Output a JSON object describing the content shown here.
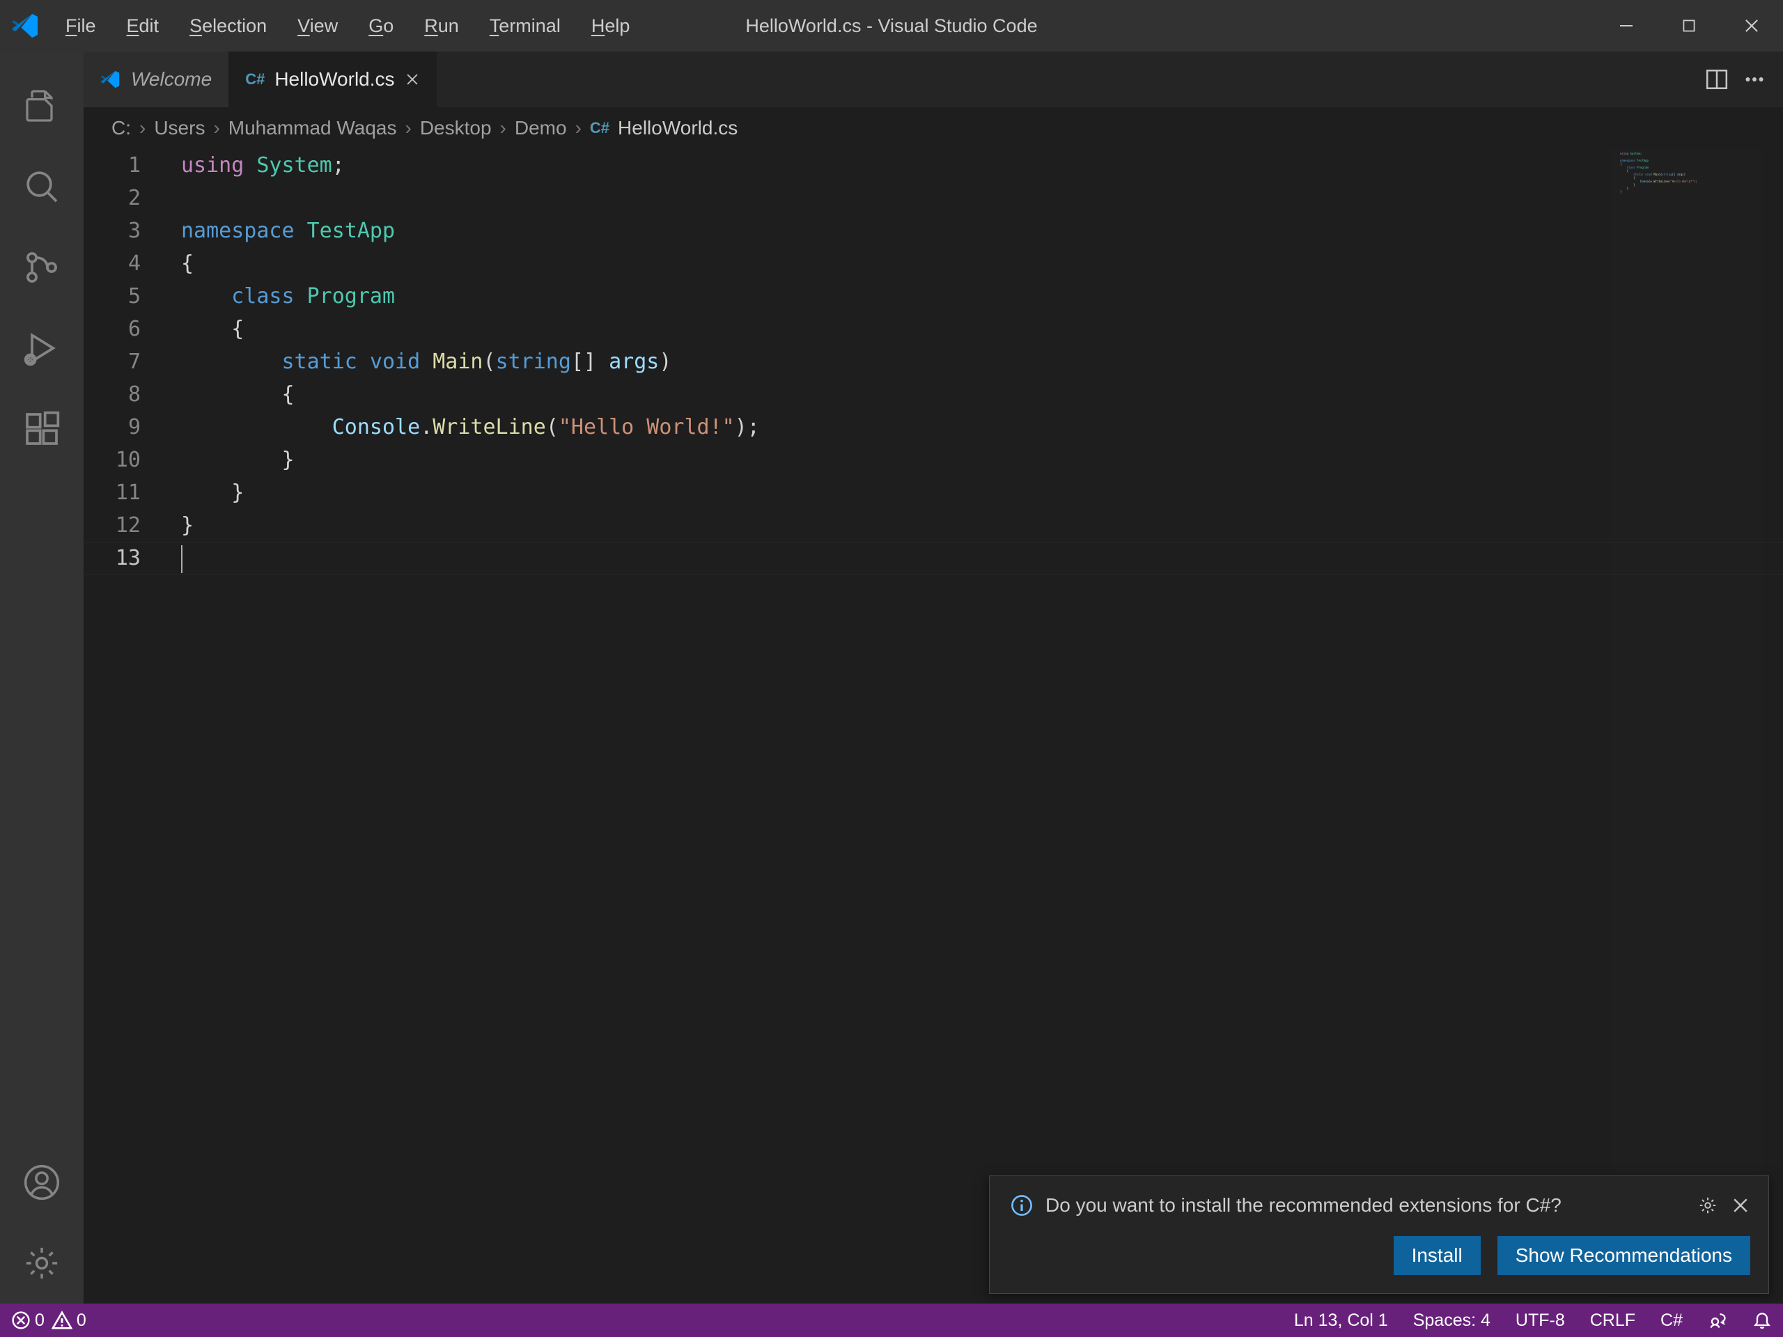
{
  "window": {
    "title": "HelloWorld.cs - Visual Studio Code"
  },
  "menubar": [
    "File",
    "Edit",
    "Selection",
    "View",
    "Go",
    "Run",
    "Terminal",
    "Help"
  ],
  "tabs": {
    "welcome": "Welcome",
    "active": "HelloWorld.cs"
  },
  "breadcrumb": [
    "C:",
    "Users",
    "Muhammad Waqas",
    "Desktop",
    "Demo",
    "HelloWorld.cs"
  ],
  "code": {
    "lines": 13,
    "l1_using": "using",
    "l1_system": "System",
    "l3_namespace": "namespace",
    "l3_name": "TestApp",
    "l5_class": "class",
    "l5_name": "Program",
    "l7_static": "static",
    "l7_void": "void",
    "l7_main": "Main",
    "l7_string": "string",
    "l7_args": "args",
    "l9_console": "Console",
    "l9_writeline": "WriteLine",
    "l9_str": "\"Hello World!\""
  },
  "notification": {
    "message": "Do you want to install the recommended extensions for C#?",
    "install": "Install",
    "show": "Show Recommendations"
  },
  "status": {
    "errors": "0",
    "warnings": "0",
    "position": "Ln 13, Col 1",
    "spaces": "Spaces: 4",
    "encoding": "UTF-8",
    "eol": "CRLF",
    "lang": "C#"
  }
}
